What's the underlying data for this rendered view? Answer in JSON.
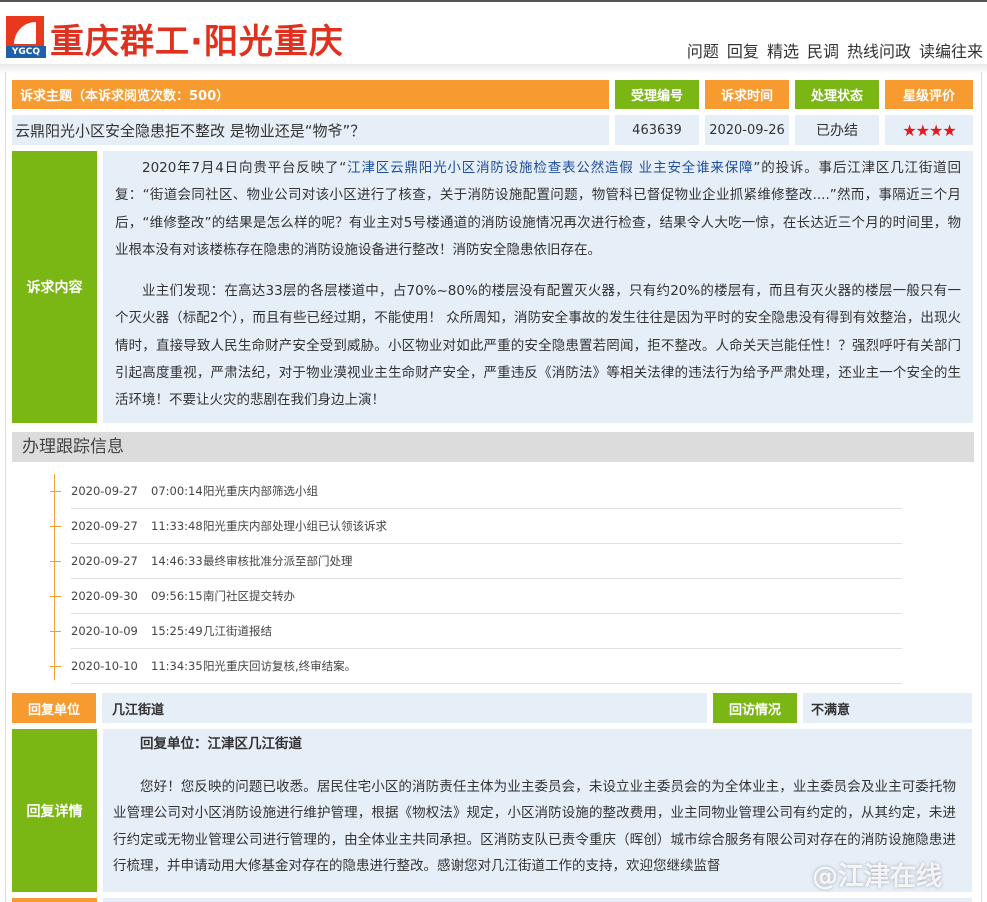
{
  "header": {
    "logo_text": "YGCQ",
    "site_title": "重庆群工·阳光重庆",
    "nav": [
      "问题",
      "回复",
      "精选",
      "民调",
      "热线问政",
      "读编往来"
    ]
  },
  "complaint": {
    "subject_header": "诉求主题（本诉求阅览次数：500）",
    "col_id": "受理编号",
    "col_time": "诉求时间",
    "col_status": "处理状态",
    "col_rating": "星级评价",
    "subject": "云鼎阳光小区安全隐患拒不整改 是物业还是“物爷”？",
    "id": "463639",
    "date": "2020-09-26",
    "status": "已办结",
    "rating_stars": "★★★★",
    "rating_value": 4,
    "content_label": "诉求内容",
    "p1_pre": "2020年7月4日向贵平台反映了“",
    "p1_link": "江津区云鼎阳光小区消防设施检查表公然造假 业主安全谁来保障",
    "p1_post": "”的投诉。事后江津区几江街道回复：“街道会同社区、物业公司对该小区进行了核查，关于消防设施配置问题，物管科已督促物业企业抓紧维修整改....”然而，事隔近三个月后，“维修整改”的结果是怎么样的呢？有业主对5号楼通道的消防设施情况再次进行检查，结果令人大吃一惊，在长达近三个月的时间里，物业根本没有对该楼栋存在隐患的消防设施设备进行整改！消防安全隐患依旧存在。",
    "p2": "业主们发现：在高达33层的各层楼道中，占70%~80%的楼层没有配置灭火器，只有约20%的楼层有，而且有灭火器的楼层一般只有一个灭火器（标配2个），而且有些已经过期，不能使用！ 众所周知，消防安全事故的发生往往是因为平时的安全隐患没有得到有效整治，出现火情时，直接导致人民生命财产安全受到威胁。小区物业对如此严重的安全隐患置若罔闻，拒不整改。人命关天岂能任性！？强烈呼吁有关部门引起高度重视，严肃法纪，对于物业漠视业主生命财产安全，严重违反《消防法》等相关法律的违法行为给予严肃处理，还业主一个安全的生活环境！不要让火灾的悲剧在我们身边上演！"
  },
  "tracking": {
    "title": "办理跟踪信息",
    "items": [
      {
        "date": "2020-09-27",
        "time": "07:00:14",
        "text": "阳光重庆内部筛选小组"
      },
      {
        "date": "2020-09-27",
        "time": "11:33:48",
        "text": "阳光重庆内部处理小组已认领该诉求"
      },
      {
        "date": "2020-09-27",
        "time": "14:46:33",
        "text": "最终审核批准分派至部门处理"
      },
      {
        "date": "2020-09-30",
        "time": "09:56:15",
        "text": "南门社区提交转办"
      },
      {
        "date": "2020-10-09",
        "time": "15:25:49",
        "text": "几江街道报结"
      },
      {
        "date": "2020-10-10",
        "time": "11:34:35",
        "text": "阳光重庆回访复核,终审结案。"
      }
    ]
  },
  "reply": {
    "unit_label": "回复单位",
    "unit": "几江街道",
    "visit_label": "回访情况",
    "visit": "不满意",
    "detail_label": "回复详情",
    "detail_unit": "回复单位：江津区几江街道",
    "detail_body": "您好！您反映的问题已收悉。居民住宅小区的消防责任主体为业主委员会，未设立业主委员会的为全体业主，业主委员会及业主可委托物业管理公司对小区消防设施进行维护管理，根据《物权法》规定，小区消防设施的整改费用，业主同物业管理公司有约定的，从其约定，未进行约定或无物业管理公司进行管理的，由全体业主共同承担。区消防支队已责令重庆（晖创）城市综合服务有限公司对存在的消防设施隐患进行梳理，并申请动用大修基金对存在的隐患进行整改。感谢您对几江街道工作的支持，欢迎您继续监督"
  },
  "watermark": "@江津在线",
  "colors": {
    "orange": "#f79a2f",
    "green": "#7ab614",
    "light_blue": "#e6eef8",
    "brand_red": "#e0301e",
    "link_blue": "#1f4e9e"
  }
}
